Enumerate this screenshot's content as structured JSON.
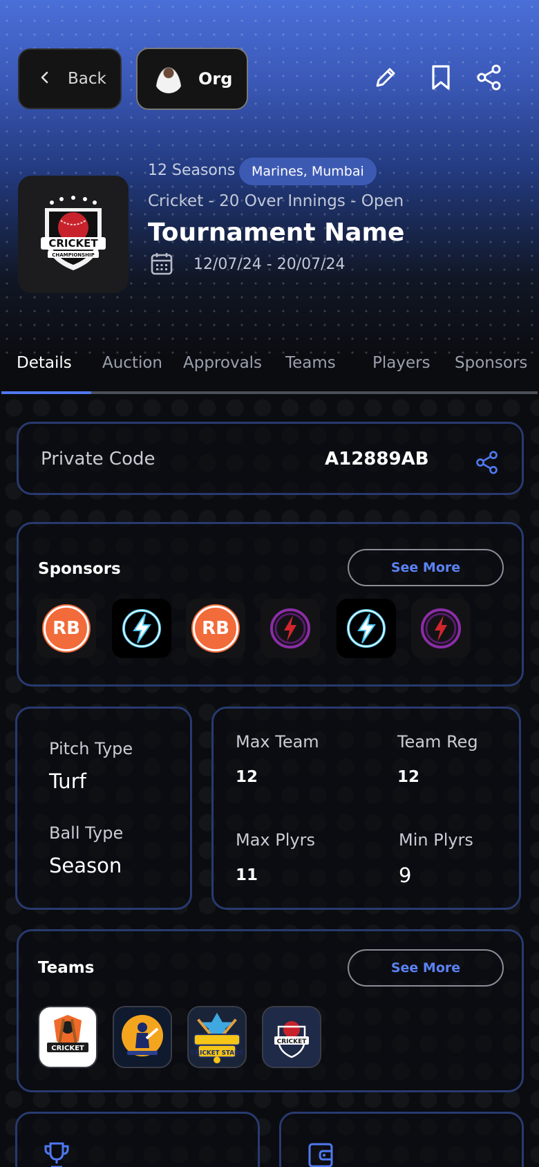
{
  "header": {
    "back_label": "Back",
    "org_label": "Org",
    "icons": [
      "pencil-icon",
      "bookmark-icon",
      "share-icon"
    ]
  },
  "tournament": {
    "seasons": "12 Seasons",
    "location": "Marines, Mumbai",
    "format": "Cricket - 20 Over Innings - Open",
    "name": "Tournament Name",
    "dates": "12/07/24 - 20/07/24",
    "logo_text_1": "CRICKET",
    "logo_text_2": "CHAMPIONSHIP"
  },
  "tabs": [
    {
      "label": "Details",
      "active": true
    },
    {
      "label": "Auction"
    },
    {
      "label": "Approvals"
    },
    {
      "label": "Teams"
    },
    {
      "label": "Players"
    },
    {
      "label": "Sponsors"
    }
  ],
  "private_code": {
    "label": "Private Code",
    "value": "A12889AB"
  },
  "sponsors": {
    "title": "Sponsors",
    "see_more": "See More",
    "logos": [
      "rb-logo",
      "bolt-logo",
      "rb-logo",
      "red-bolt-logo",
      "bolt-logo",
      "red-bolt-logo"
    ],
    "rb_text": "RB"
  },
  "pitch": {
    "pitch_label": "Pitch Type",
    "pitch_value": "Turf",
    "ball_label": "Ball Type",
    "ball_value": "Season"
  },
  "limits": {
    "max_team_label": "Max Team",
    "max_team_value": "12",
    "team_reg_label": "Team Reg",
    "team_reg_value": "12",
    "max_plyrs_label": "Max Plyrs",
    "max_plyrs_value": "11",
    "min_plyrs_label": "Min Plyrs",
    "min_plyrs_value": "9"
  },
  "teams": {
    "title": "Teams",
    "see_more": "See More",
    "logo_texts": [
      "CRICKET",
      "",
      "CRICKET STARS",
      "CRICKET"
    ]
  },
  "bottom_icons": [
    "trophy-icon",
    "wallet-icon"
  ],
  "colors": {
    "accent": "#4f79f0",
    "card_border": "#283a70",
    "badge": "#3d5ab3"
  }
}
